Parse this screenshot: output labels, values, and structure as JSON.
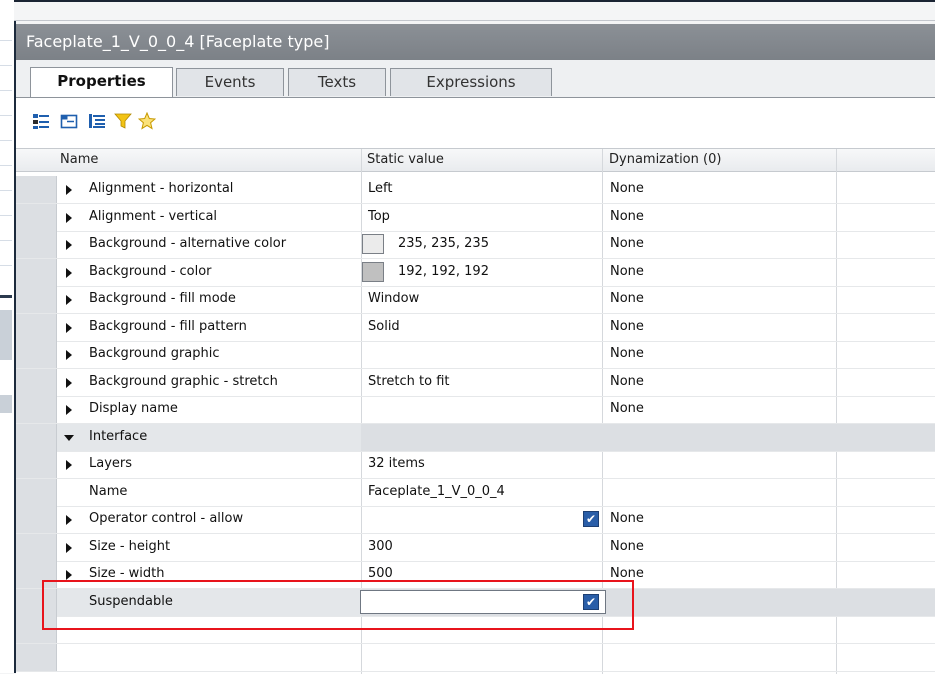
{
  "window": {
    "title": "Faceplate_1_V_0_0_4 [Faceplate type]"
  },
  "tabs": [
    {
      "label": "Properties",
      "active": true
    },
    {
      "label": "Events",
      "active": false
    },
    {
      "label": "Texts",
      "active": false
    },
    {
      "label": "Expressions",
      "active": false
    }
  ],
  "toolbar_icons": [
    "categorized-view-icon",
    "alphabetical-view-icon",
    "tree-view-icon",
    "filter-icon",
    "favorites-star-icon"
  ],
  "grid": {
    "headers": {
      "name": "Name",
      "static_value": "Static value",
      "dynamization": "Dynamization (0)"
    },
    "rows": [
      {
        "name": "Alignment - horizontal",
        "value": "Left",
        "dynamization": "None",
        "expander": "collapsed"
      },
      {
        "name": "Alignment - vertical",
        "value": "Top",
        "dynamization": "None",
        "expander": "collapsed"
      },
      {
        "name": "Background - alternative color",
        "value": "235, 235, 235",
        "swatch": "#ebebeb",
        "dynamization": "None",
        "expander": "collapsed"
      },
      {
        "name": "Background - color",
        "value": "192, 192, 192",
        "swatch": "#c0c0c0",
        "dynamization": "None",
        "expander": "collapsed"
      },
      {
        "name": "Background - fill mode",
        "value": "Window",
        "dynamization": "None",
        "expander": "collapsed"
      },
      {
        "name": "Background - fill pattern",
        "value": "Solid",
        "dynamization": "None",
        "expander": "collapsed"
      },
      {
        "name": "Background graphic",
        "value": "",
        "dynamization": "None",
        "expander": "collapsed"
      },
      {
        "name": "Background graphic - stretch",
        "value": "Stretch to fit",
        "dynamization": "None",
        "expander": "collapsed"
      },
      {
        "name": "Display name",
        "value": "",
        "dynamization": "None",
        "expander": "collapsed"
      },
      {
        "name": "Interface",
        "value": "",
        "dynamization": "",
        "expander": "expanded"
      },
      {
        "name": "Layers",
        "value": "32 items",
        "dynamization": "",
        "expander": "collapsed"
      },
      {
        "name": "Name",
        "value": "Faceplate_1_V_0_0_4",
        "dynamization": "",
        "expander": "none"
      },
      {
        "name": "Operator control - allow",
        "value": "",
        "checked": true,
        "dynamization": "None",
        "expander": "collapsed"
      },
      {
        "name": "Size - height",
        "value": "300",
        "dynamization": "None",
        "expander": "collapsed"
      },
      {
        "name": "Size - width",
        "value": "500",
        "dynamization": "None",
        "expander": "collapsed"
      },
      {
        "name": "Suspendable",
        "value": "",
        "checked": true,
        "dynamization": "",
        "expander": "none",
        "editing": true
      }
    ]
  },
  "colors": {
    "highlight": "#e8141c",
    "title_bar": "#8b9096",
    "checkbox": "#2a5ea8"
  }
}
